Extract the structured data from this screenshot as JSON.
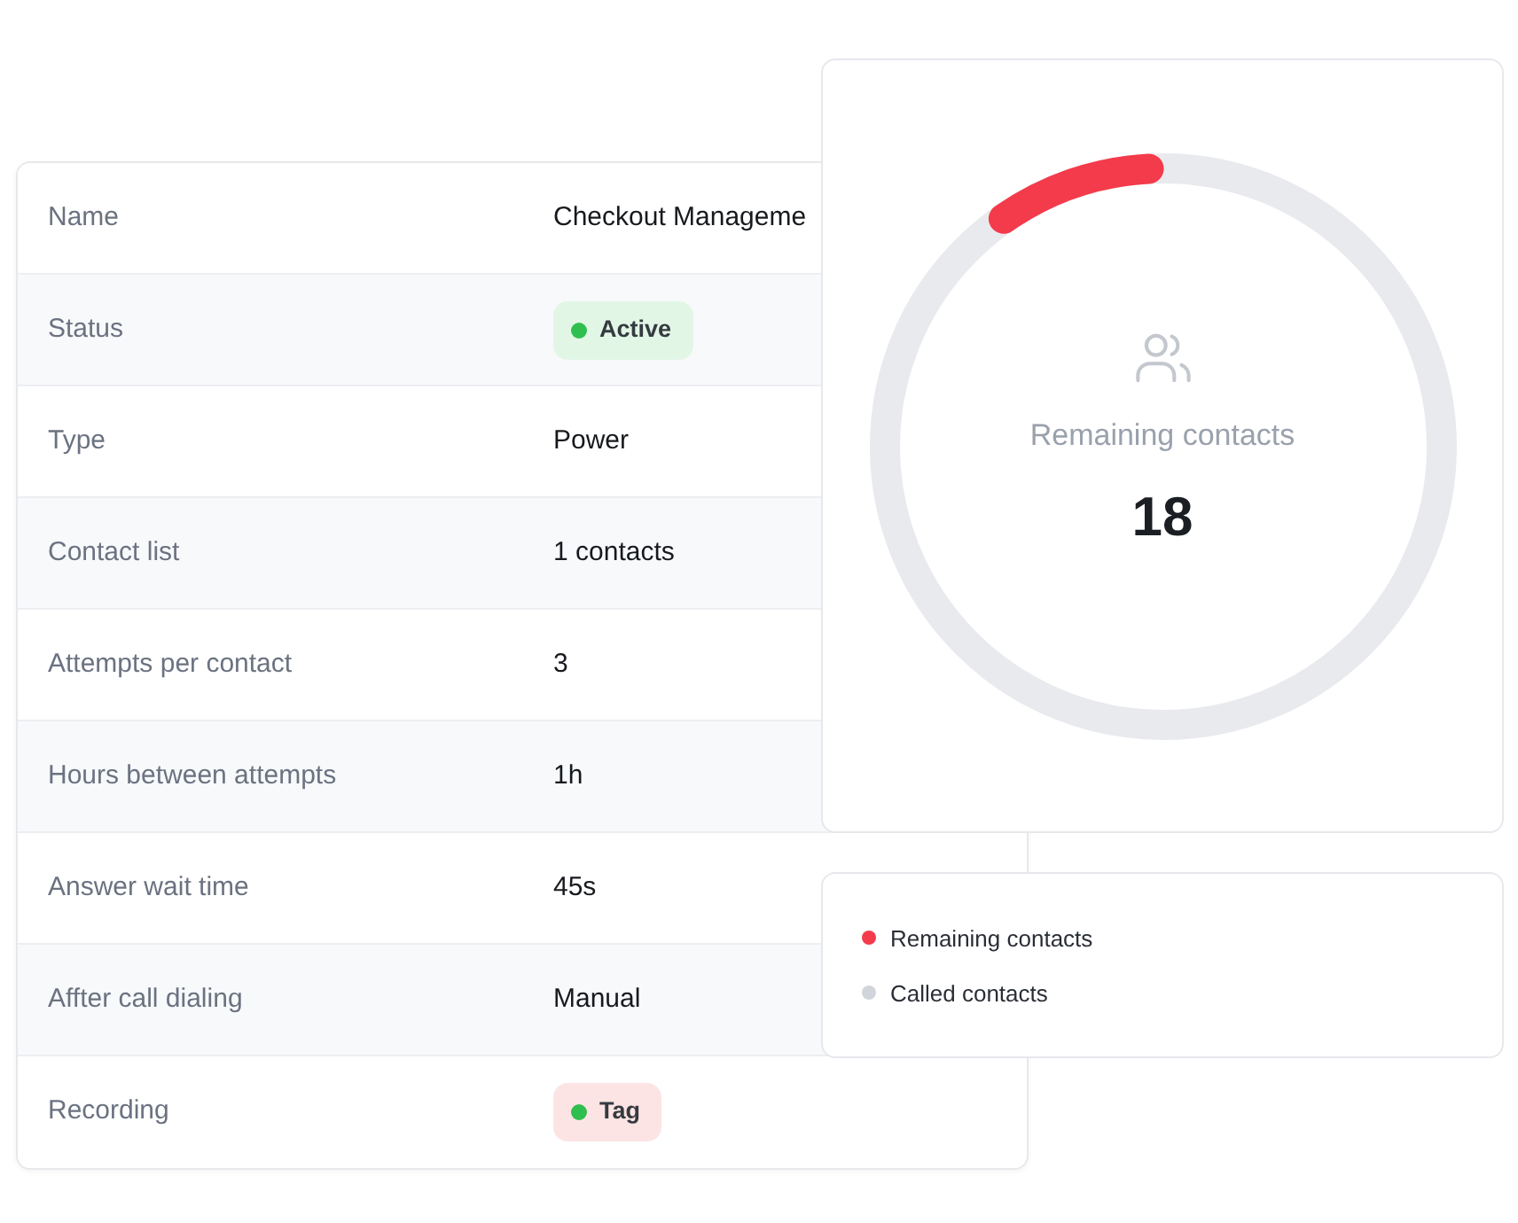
{
  "details": {
    "rows": [
      {
        "label": "Name",
        "kind": "text",
        "value": "Checkout Manageme"
      },
      {
        "label": "Status",
        "kind": "badge",
        "value": "Active",
        "color": "#e2f6e5"
      },
      {
        "label": "Type",
        "kind": "text",
        "value": "Power"
      },
      {
        "label": "Contact list",
        "kind": "text",
        "value": "1 contacts"
      },
      {
        "label": "Attempts per contact",
        "kind": "text",
        "value": "3"
      },
      {
        "label": "Hours between attempts",
        "kind": "text",
        "value": "1h"
      },
      {
        "label": "Answer wait time",
        "kind": "text",
        "value": "45s"
      },
      {
        "label": "Affter call dialing",
        "kind": "text",
        "value": "Manual"
      },
      {
        "label": "Recording",
        "kind": "badge",
        "value": "Tag",
        "color": "#fde4e4"
      }
    ]
  },
  "summary": {
    "title": "Remaining contacts",
    "count": "18"
  },
  "legend": [
    {
      "label": "Remaining contacts",
      "color": "#f43b4b"
    },
    {
      "label": "Called contacts",
      "color": "#d1d5db"
    }
  ]
}
